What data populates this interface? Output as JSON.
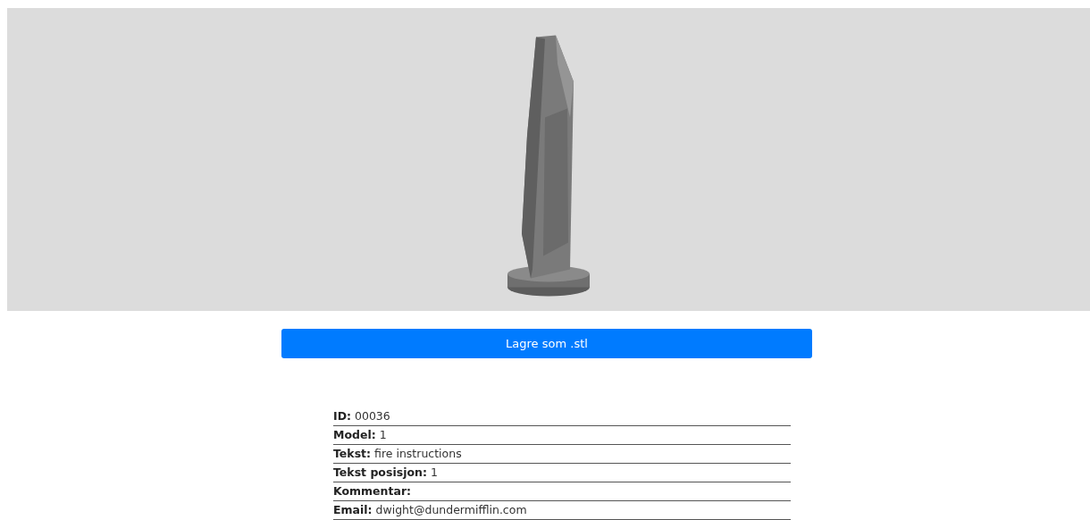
{
  "save_button": {
    "label": "Lagre som .stl"
  },
  "details": [
    {
      "label": "ID:",
      "value": "00036"
    },
    {
      "label": "Model:",
      "value": "1"
    },
    {
      "label": "Tekst:",
      "value": "fire instructions"
    },
    {
      "label": "Tekst posisjon:",
      "value": "1"
    },
    {
      "label": "Kommentar:"
    },
    {
      "label": "Email:",
      "value": "dwight@dundermifflin.com"
    }
  ]
}
